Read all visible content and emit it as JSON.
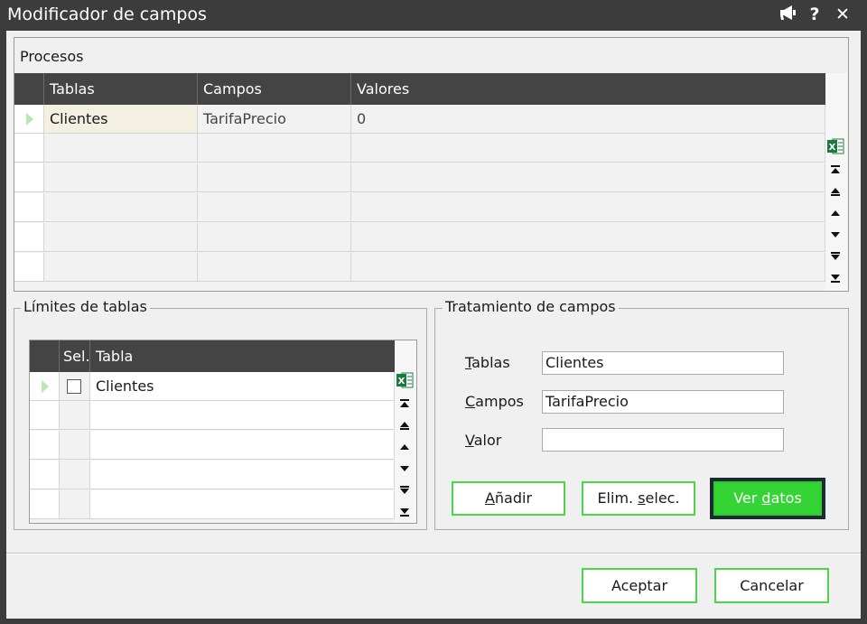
{
  "window": {
    "title": "Modificador de campos",
    "icons": [
      "megaphone-icon",
      "help-icon",
      "close-icon"
    ],
    "help_glyph": "?",
    "close_glyph": "✕"
  },
  "procesos": {
    "label": "Procesos",
    "columns": [
      "Tablas",
      "Campos",
      "Valores"
    ],
    "rows": [
      {
        "tablas": "Clientes",
        "campos": "TarifaPrecio",
        "valores": "0"
      }
    ]
  },
  "limites": {
    "label": "Límites de tablas",
    "columns": [
      "Sel.",
      "Tabla"
    ],
    "rows": [
      {
        "sel": false,
        "tabla": "Clientes"
      }
    ]
  },
  "tratamiento": {
    "label": "Tratamiento de campos",
    "tablas": {
      "label_ul": "T",
      "label_rest": "ablas",
      "value": "Clientes"
    },
    "campos": {
      "label_ul": "C",
      "label_rest": "ampos",
      "value": "TarifaPrecio"
    },
    "valor": {
      "label_ul": "V",
      "label_rest": "alor",
      "value": ""
    },
    "buttons": {
      "anadir": {
        "ul": "A",
        "rest": "ñadir"
      },
      "elim": {
        "pre": "Elim. ",
        "ul": "s",
        "rest": "elec."
      },
      "ver": {
        "pre": "Ver ",
        "ul": "d",
        "rest": "atos"
      }
    }
  },
  "footer": {
    "aceptar": "Aceptar",
    "cancelar": "Cancelar"
  },
  "colors": {
    "accent_green": "#33d433",
    "header_dark": "#444444",
    "title_bar": "#3c3c3c",
    "row_indicator": "#b9e6b3"
  }
}
